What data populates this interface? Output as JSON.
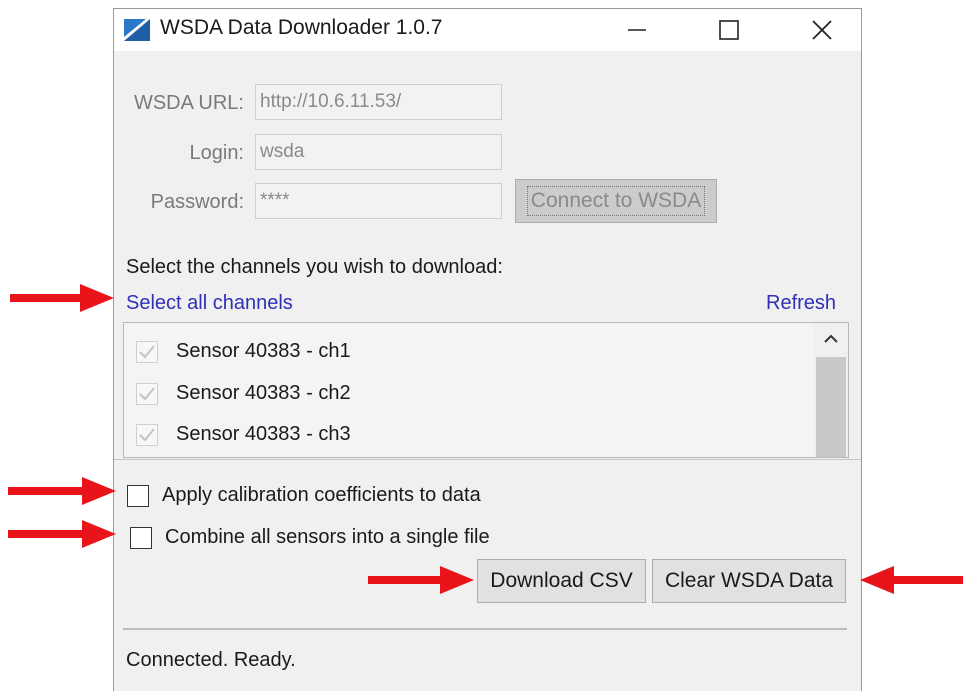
{
  "window": {
    "title": "WSDA Data Downloader 1.0.7"
  },
  "form": {
    "url_label": "WSDA URL:",
    "url_value": "http://10.6.11.53/",
    "login_label": "Login:",
    "login_value": "wsda",
    "password_label": "Password:",
    "password_value": "****",
    "connect_button": "Connect to WSDA"
  },
  "channels": {
    "prompt": "Select the channels you wish to download:",
    "select_all": "Select all channels",
    "refresh": "Refresh",
    "items": [
      {
        "label": "Sensor 40383 - ch1",
        "checked": true
      },
      {
        "label": "Sensor 40383 - ch2",
        "checked": true
      },
      {
        "label": "Sensor 40383 - ch3",
        "checked": true
      }
    ]
  },
  "options": {
    "calibration": "Apply calibration coefficients to data",
    "combine": "Combine all sensors into a single file"
  },
  "actions": {
    "download": "Download CSV",
    "clear": "Clear WSDA Data"
  },
  "status": "Connected. Ready.",
  "colors": {
    "link": "#2f2fb8",
    "arrow": "#e8141a",
    "app_icon": "#1f5fa8"
  }
}
